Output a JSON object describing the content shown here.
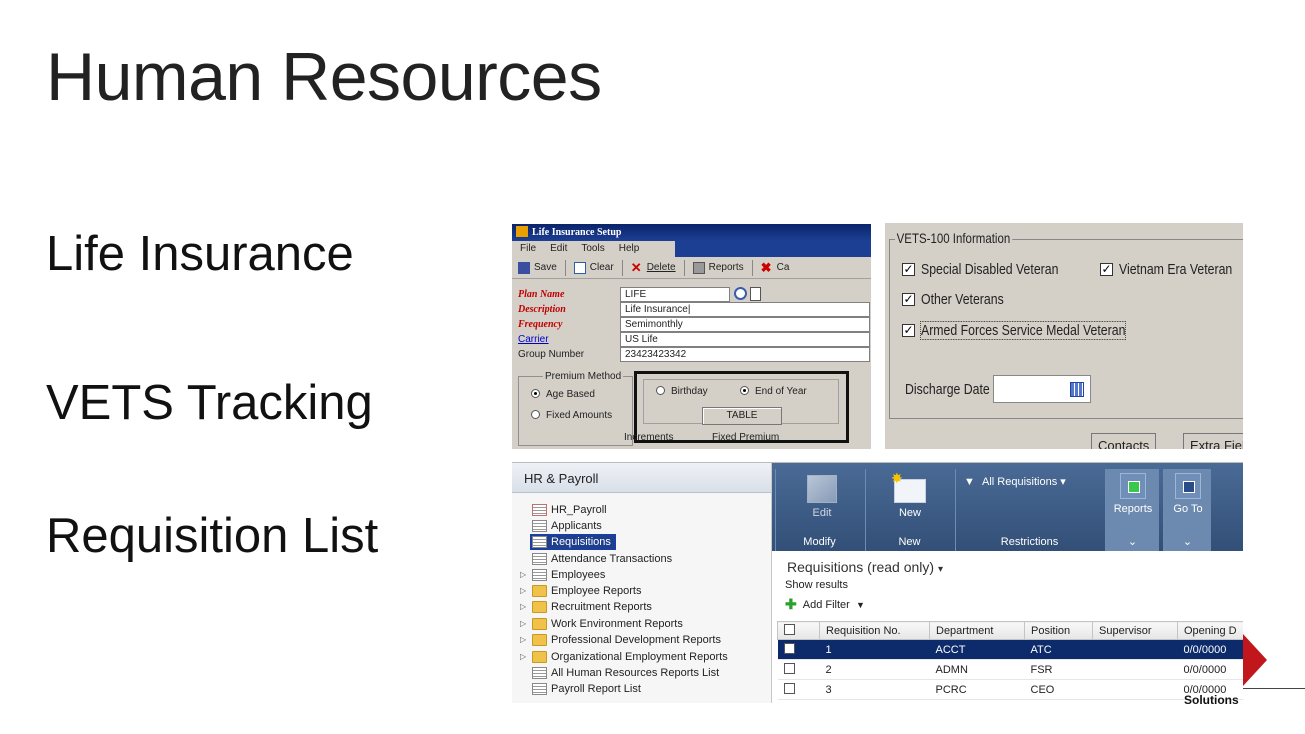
{
  "slide": {
    "title": "Human Resources",
    "bullets": [
      "Life Insurance",
      "VETS Tracking",
      "Requisition List"
    ]
  },
  "life_insurance": {
    "window_title": "Life Insurance Setup",
    "menu": [
      "File",
      "Edit",
      "Tools",
      "Help"
    ],
    "toolbar": {
      "save": "Save",
      "clear": "Clear",
      "delete": "Delete",
      "reports": "Reports",
      "cancel_partial": "Ca"
    },
    "fields": [
      {
        "label": "Plan Name",
        "value": "LIFE"
      },
      {
        "label": "Description",
        "value": "Life Insurance|"
      },
      {
        "label": "Frequency",
        "value": "Semimonthly"
      },
      {
        "label": "Carrier",
        "value": "US Life"
      },
      {
        "label": "Group Number",
        "value": "23423423342"
      }
    ],
    "premium_method": {
      "legend": "Premium Method",
      "age_based": "Age Based",
      "fixed_amounts": "Fixed Amounts"
    },
    "birthday": "Birthday",
    "end_of_year": "End of Year",
    "table_button": "TABLE",
    "cut_labels": {
      "increments": "Increments",
      "fixed_premium": "Fixed Premium"
    }
  },
  "vets": {
    "legend": "VETS-100 Information",
    "checkboxes": {
      "special_disabled": "Special Disabled Veteran",
      "vietnam_era": "Vietnam Era Veteran",
      "other_veterans": "Other Veterans",
      "armed_forces": "Armed Forces Service Medal Veteran"
    },
    "discharge_date_label": "Discharge Date",
    "cut_buttons": {
      "contacts": "Contacts",
      "extra_fields": "Extra Fiel"
    }
  },
  "requisitions": {
    "nav_title": "HR & Payroll",
    "nav_items": [
      "HR_Payroll",
      "Applicants",
      "Requisitions",
      "Attendance Transactions",
      "Employees",
      "Employee Reports",
      "Recruitment Reports",
      "Work Environment Reports",
      "Professional Development Reports",
      "Organizational Employment Reports",
      "All Human Resources Reports List",
      "Payroll Report List"
    ],
    "ribbon": {
      "edit": "Edit",
      "new": "New",
      "all_requisitions": "All Requisitions",
      "reports": "Reports",
      "go_to": "Go To",
      "groups": {
        "modify": "Modify",
        "new": "New",
        "restrictions": "Restrictions"
      }
    },
    "content_title": "Requisitions (read only)",
    "show_results": "Show results",
    "add_filter": "Add Filter",
    "columns": [
      "Requisition No.",
      "Department",
      "Position",
      "Supervisor",
      "Opening D"
    ],
    "rows": [
      {
        "no": "1",
        "department": "ACCT",
        "position": "ATC",
        "supervisor": "",
        "opening": "0/0/0000"
      },
      {
        "no": "2",
        "department": "ADMN",
        "position": "FSR",
        "supervisor": "",
        "opening": "0/0/0000"
      },
      {
        "no": "3",
        "department": "PCRC",
        "position": "CEO",
        "supervisor": "",
        "opening": "0/0/0000"
      }
    ]
  },
  "logo": {
    "text": "Solutions"
  }
}
